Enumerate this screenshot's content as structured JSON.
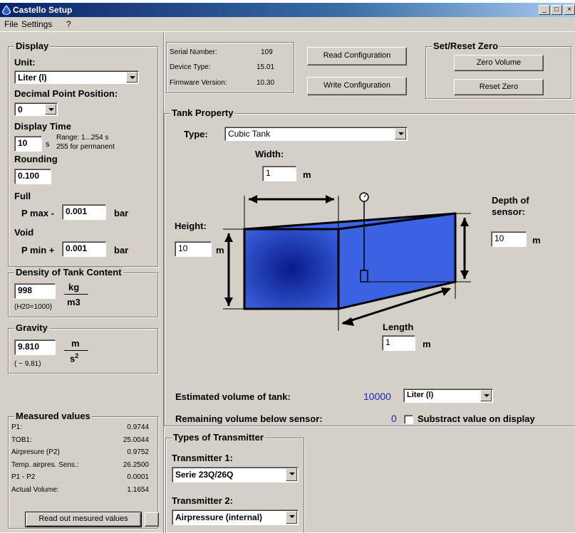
{
  "window": {
    "title": "Castello Setup",
    "min": "_",
    "max": "□",
    "close": "×"
  },
  "menu": {
    "file": "File",
    "settings": "Settings",
    "help": "?"
  },
  "display": {
    "title": "Display",
    "unit_label": "Unit:",
    "unit_value": "Liter (l)",
    "decimal_label": "Decimal Point Position:",
    "decimal_value": "0",
    "display_time_label": "Display Time",
    "display_time_value": "10",
    "display_time_unit": "s",
    "range_line1": "Range: 1...254 s",
    "range_line2": "255 for permanent",
    "rounding_label": "Rounding",
    "rounding_value": "0.100",
    "full_label": "Full",
    "pmax_label": "P max -",
    "pmax_value": "0.001",
    "pmax_unit": "bar",
    "void_label": "Void",
    "pmin_label": "P min +",
    "pmin_value": "0.001",
    "pmin_unit": "bar"
  },
  "density": {
    "title": "Density of Tank Content",
    "value": "998",
    "unit_num": "kg",
    "unit_den": "m3",
    "hint": "(H20=1000)"
  },
  "gravity": {
    "title": "Gravity",
    "value": "9.810",
    "unit_num": "m",
    "unit_den": "s",
    "unit_exp": "2",
    "hint": "( ~ 9.81)"
  },
  "measured": {
    "title": "Measured values",
    "rows": [
      {
        "label": "P1:",
        "value": "0.9744"
      },
      {
        "label": "TOB1:",
        "value": "25.0044"
      },
      {
        "label": "Airpresure (P2)",
        "value": "0.9752"
      },
      {
        "label": "Temp. airpres. Sens.:",
        "value": "26.2500"
      },
      {
        "label": "P1 - P2",
        "value": "0.0001"
      },
      {
        "label": "Actual Volume:",
        "value": "1.1654"
      }
    ],
    "read_button": "Read out mesured values"
  },
  "device": {
    "serial_label": "Serial Number:",
    "serial_value": "109",
    "type_label": "Device Type:",
    "type_value": "15.01",
    "firmware_label": "Firmware Version:",
    "firmware_value": "10.30",
    "read_config": "Read Configuration",
    "write_config": "Write Configuration"
  },
  "zero": {
    "title": "Set/Reset Zero",
    "zero_volume": "Zero Volume",
    "reset_zero": "Reset Zero"
  },
  "tank": {
    "title": "Tank Property",
    "type_label": "Type:",
    "type_value": "Cubic Tank",
    "width_label": "Width:",
    "width_value": "1",
    "width_unit": "m",
    "height_label": "Height:",
    "height_value": "10",
    "height_unit": "m",
    "depth_label_1": "Depth of",
    "depth_label_2": "sensor:",
    "depth_value": "10",
    "depth_unit": "m",
    "length_label": "Length",
    "length_value": "1",
    "length_unit": "m",
    "est_label": "Estimated volume of tank:",
    "est_value": "10000",
    "est_unit": "Liter (l)",
    "rem_label": "Remaining volume below sensor:",
    "rem_value": "0",
    "subtract_label": "Substract value on display",
    "colors": {
      "value_text": "#1f1fc8",
      "tank_fill": "#3a63e0",
      "tank_dark": "#0a1b8a"
    }
  },
  "transmitter": {
    "title": "Types of Transmitter",
    "t1_label": "Transmitter 1:",
    "t1_value": "Serie 23Q/26Q",
    "t2_label": "Transmitter 2:",
    "t2_value": "Airpressure (internal)"
  }
}
